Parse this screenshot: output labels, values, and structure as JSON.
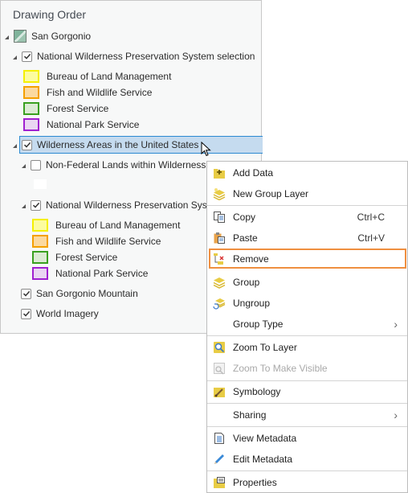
{
  "pane": {
    "title": "Drawing Order",
    "map": {
      "label": "San Gorgonio",
      "icon": "map-icon"
    },
    "layers": [
      {
        "label": "National Wilderness Preservation System selection",
        "checked": true,
        "legend": [
          {
            "label": "Bureau of Land Management",
            "fill": "#fcfca0",
            "stroke": "#f5f000"
          },
          {
            "label": "Fish and Wildlife Service",
            "fill": "#fbd9a0",
            "stroke": "#f5a000"
          },
          {
            "label": "Forest Service",
            "fill": "#dcebd4",
            "stroke": "#3aa020"
          },
          {
            "label": "National Park Service",
            "fill": "#ead6f2",
            "stroke": "#a020d0"
          }
        ]
      },
      {
        "label": "Wilderness Areas in the United States",
        "checked": true,
        "selected": true,
        "children": [
          {
            "label": "Non-Federal Lands within Wilderness",
            "checked": false
          },
          {
            "label": "National Wilderness Preservation System",
            "checked": true,
            "legend": [
              {
                "label": "Bureau of Land Management",
                "fill": "#fcfca0",
                "stroke": "#f5f000"
              },
              {
                "label": "Fish and Wildlife Service",
                "fill": "#fbd9a0",
                "stroke": "#f5a000"
              },
              {
                "label": "Forest Service",
                "fill": "#dcebd4",
                "stroke": "#3aa020"
              },
              {
                "label": "National Park Service",
                "fill": "#ead6f2",
                "stroke": "#a020d0"
              }
            ]
          }
        ]
      },
      {
        "label": "San Gorgonio Mountain",
        "checked": true
      },
      {
        "label": "World Imagery",
        "checked": true
      }
    ]
  },
  "context_menu": {
    "items": [
      {
        "label": "Add Data",
        "icon": "add-data-icon"
      },
      {
        "label": "New Group Layer",
        "icon": "new-group-layer-icon"
      },
      {
        "label": "Copy",
        "shortcut": "Ctrl+C",
        "icon": "copy-icon"
      },
      {
        "label": "Paste",
        "shortcut": "Ctrl+V",
        "icon": "paste-icon"
      },
      {
        "label": "Remove",
        "icon": "remove-icon",
        "highlighted": true
      },
      {
        "label": "Group",
        "icon": "group-icon"
      },
      {
        "label": "Ungroup",
        "icon": "ungroup-icon"
      },
      {
        "label": "Group Type",
        "submenu": true
      },
      {
        "label": "Zoom To Layer",
        "icon": "zoom-to-layer-icon"
      },
      {
        "label": "Zoom To Make Visible",
        "icon": "zoom-to-make-visible-icon",
        "disabled": true
      },
      {
        "label": "Symbology",
        "icon": "symbology-icon"
      },
      {
        "label": "Sharing",
        "submenu": true
      },
      {
        "label": "View Metadata",
        "icon": "view-metadata-icon"
      },
      {
        "label": "Edit Metadata",
        "icon": "edit-metadata-icon"
      },
      {
        "label": "Properties",
        "icon": "properties-icon"
      }
    ],
    "highlight_color": "#ef8f40"
  },
  "colors": {
    "selection_fill": "#c5dbef",
    "selection_border": "#2c8ad2"
  }
}
